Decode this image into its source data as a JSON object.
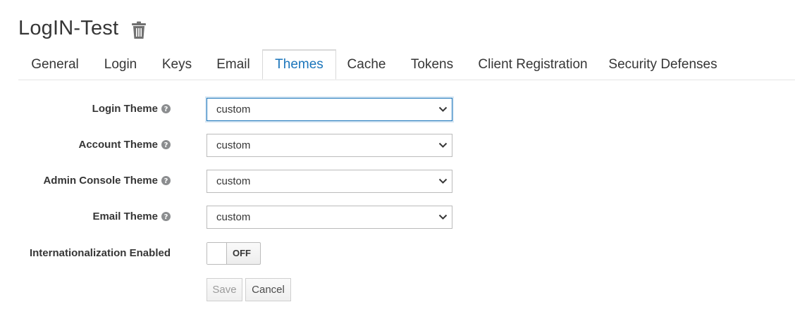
{
  "header": {
    "title": "LogIN-Test",
    "delete_icon": "trash-icon"
  },
  "tabs": [
    {
      "label": "General"
    },
    {
      "label": "Login"
    },
    {
      "label": "Keys"
    },
    {
      "label": "Email"
    },
    {
      "label": "Themes",
      "active": true
    },
    {
      "label": "Cache"
    },
    {
      "label": "Tokens"
    },
    {
      "label": "Client Registration"
    },
    {
      "label": "Security Defenses"
    }
  ],
  "form": {
    "login_theme": {
      "label": "Login Theme",
      "value": "custom"
    },
    "account_theme": {
      "label": "Account Theme",
      "value": "custom"
    },
    "admin_console_theme": {
      "label": "Admin Console Theme",
      "value": "custom"
    },
    "email_theme": {
      "label": "Email Theme",
      "value": "custom"
    },
    "internationalization": {
      "label": "Internationalization Enabled",
      "value": "OFF"
    }
  },
  "buttons": {
    "save": "Save",
    "cancel": "Cancel"
  },
  "colors": {
    "accent": "#1b75bb",
    "text": "#363636",
    "help_icon": "#8b8d8f"
  }
}
